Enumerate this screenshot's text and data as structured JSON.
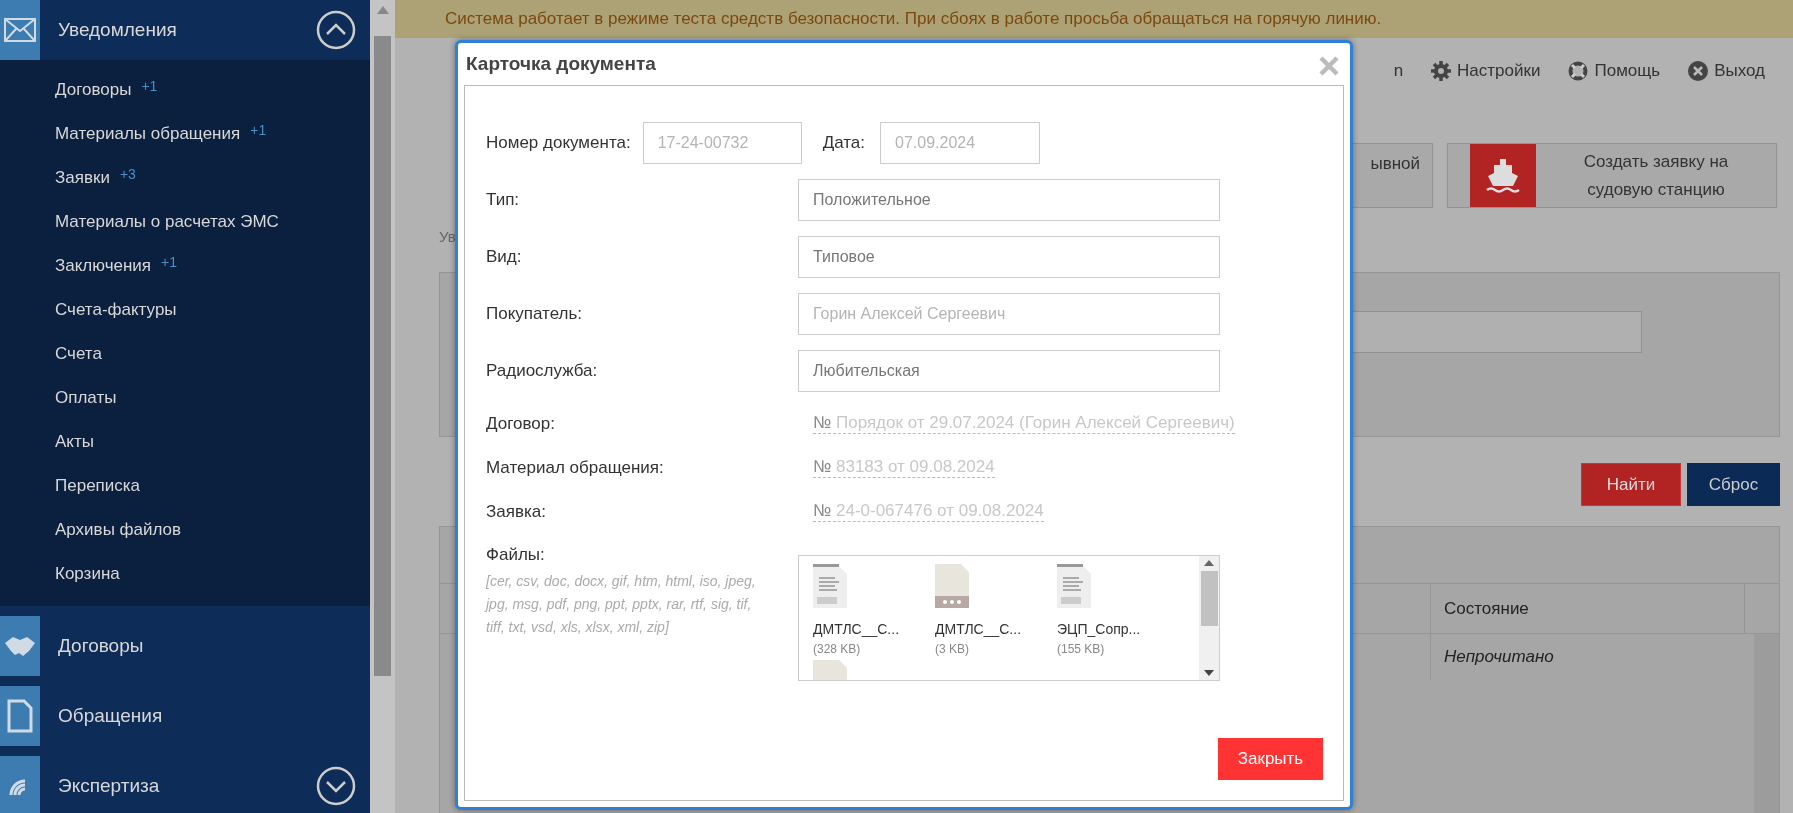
{
  "sidebar": {
    "sections": [
      {
        "label": "Уведомления",
        "expanded": true,
        "items": [
          {
            "label": "Договоры",
            "badge": "+1"
          },
          {
            "label": "Материалы обращения",
            "badge": "+1"
          },
          {
            "label": "Заявки",
            "badge": "+3"
          },
          {
            "label": "Материалы о расчетах ЭМС"
          },
          {
            "label": "Заключения",
            "badge": "+1"
          },
          {
            "label": "Счета-фактуры"
          },
          {
            "label": "Счета"
          },
          {
            "label": "Оплаты"
          },
          {
            "label": "Акты"
          },
          {
            "label": "Переписка"
          },
          {
            "label": "Архивы файлов"
          },
          {
            "label": "Корзина"
          }
        ]
      },
      {
        "label": "Договоры"
      },
      {
        "label": "Обращения"
      },
      {
        "label": "Экспертиза",
        "expanded": false
      }
    ]
  },
  "banner": "Система работает в режиме теста средств безопасности. При сбоях в работе просьба обращаться на горячую линию.",
  "top_nav": [
    "n",
    "Настройки",
    "Помощь",
    "Выход"
  ],
  "action_buttons": [
    {
      "label": "ывной",
      "kind": "partial"
    },
    {
      "label": "Создать заявку на судовую станцию",
      "kind": "ship"
    }
  ],
  "breadcrumb": "Ув",
  "search_buttons": [
    {
      "label": "Найти",
      "kind": "primary"
    },
    {
      "label": "Сброс",
      "kind": "secondary"
    }
  ],
  "table": {
    "columns": [
      "Состояние"
    ],
    "rows": [
      {
        "state": "Непрочитано"
      }
    ]
  },
  "modal": {
    "title": "Карточка документа",
    "number_label": "Номер документа:",
    "number": "17-24-00732",
    "date_label": "Дата:",
    "date": "07.09.2024",
    "fields": [
      {
        "label": "Тип:",
        "value": "Положительное",
        "obscured": false
      },
      {
        "label": "Вид:",
        "value": "Типовое",
        "obscured": false
      },
      {
        "label": "Покупатель:",
        "value": "Горин Алексей Сергеевич",
        "obscured": true
      },
      {
        "label": "Радиослужба:",
        "value": "Любительская",
        "obscured": false
      }
    ],
    "links": [
      {
        "label": "Договор:",
        "value": "№ Порядок от 29.07.2024 (Горин Алексей Сергеевич)"
      },
      {
        "label": "Материал обращения:",
        "value": "№ 83183 от 09.08.2024"
      },
      {
        "label": "Заявка:",
        "value": "№ 24-0-067476 от 09.08.2024"
      }
    ],
    "files_label": "Файлы:",
    "extensions": "[cer, csv, doc, docx, gif, htm, html, iso, jpeg, jpg, msg, pdf, png, ppt, pptx, rar, rtf, sig, tif, tiff, txt, vsd, xls, xlsx, xml, zip]",
    "files": [
      {
        "name": "ДМТЛС__С...",
        "size": "(328 KB)",
        "kind": "rtf"
      },
      {
        "name": "ДМТЛС__С...",
        "size": "(3 KB)",
        "kind": "generic"
      },
      {
        "name": "ЭЦП_Сопр...",
        "size": "(155 KB)",
        "kind": "rtf"
      },
      {
        "kind": "generic"
      }
    ],
    "close_button": "Закрыть"
  }
}
